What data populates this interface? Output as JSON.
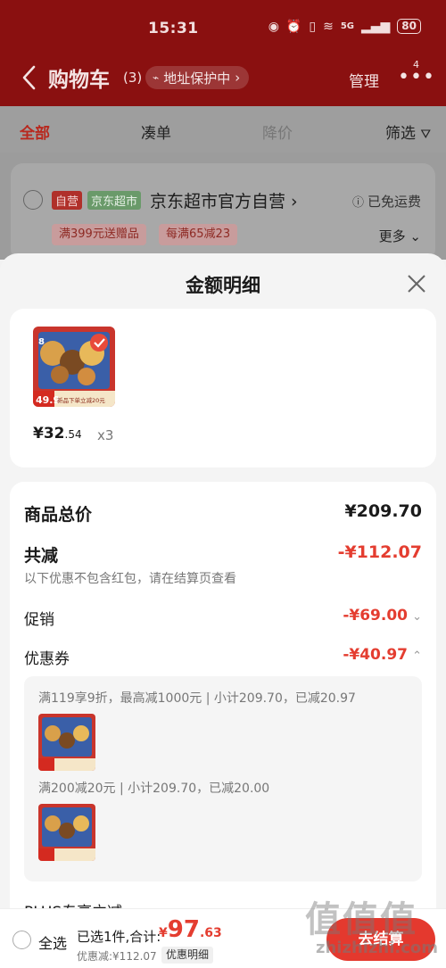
{
  "status": {
    "time": "15:31",
    "battery": "80",
    "network": "5G"
  },
  "nav": {
    "title": "购物车",
    "count": "(3)",
    "address_protect": "地址保护中",
    "manage": "管理",
    "badge": "4"
  },
  "tabs": [
    {
      "label": "全部"
    },
    {
      "label": "凑单"
    },
    {
      "label": "降价"
    },
    {
      "label": "筛选"
    }
  ],
  "store": {
    "tag_self": "自营",
    "tag_market": "京东超市",
    "name": "京东超市官方自营",
    "free_shipping": "已免运费",
    "promos": [
      "满399元送赠品",
      "每满65减23"
    ],
    "more": "更多"
  },
  "sheet": {
    "title": "金额明细",
    "product": {
      "price_main": "¥32",
      "price_dec": ".54",
      "qty": "x3",
      "img_badge_top": "8",
      "img_price": "49.9",
      "img_caption": "新品下单立减20元"
    },
    "summary": {
      "total_label": "商品总价",
      "total_value": "¥209.70",
      "reduce_label": "共减",
      "reduce_value": "-¥112.07",
      "reduce_note": "以下优惠不包含红包，请在结算页查看",
      "promo_label": "促销",
      "promo_value": "-¥69.00",
      "coupon_label": "优惠券",
      "coupon_value": "-¥40.97"
    },
    "coupons": [
      {
        "text": "满119享9折，最高减1000元 | 小计209.70，已减20.97"
      },
      {
        "text": "满200减20元 | 小计209.70，已减20.00"
      }
    ],
    "plus_label": "PLUS专享立减"
  },
  "bottom": {
    "select_all": "全选",
    "selected": "已选1件,合计:",
    "total_currency": "¥",
    "total_int": "97",
    "total_dec": ".63",
    "saved": "优惠减:¥112.07",
    "detail_btn": "优惠明细",
    "checkout": "去结算"
  },
  "watermark": {
    "text": "值值值",
    "url": "zhizhizhi.com"
  },
  "colors": {
    "header": "#8a1010",
    "accent": "#e43d30",
    "checkout": "#e4392e"
  }
}
